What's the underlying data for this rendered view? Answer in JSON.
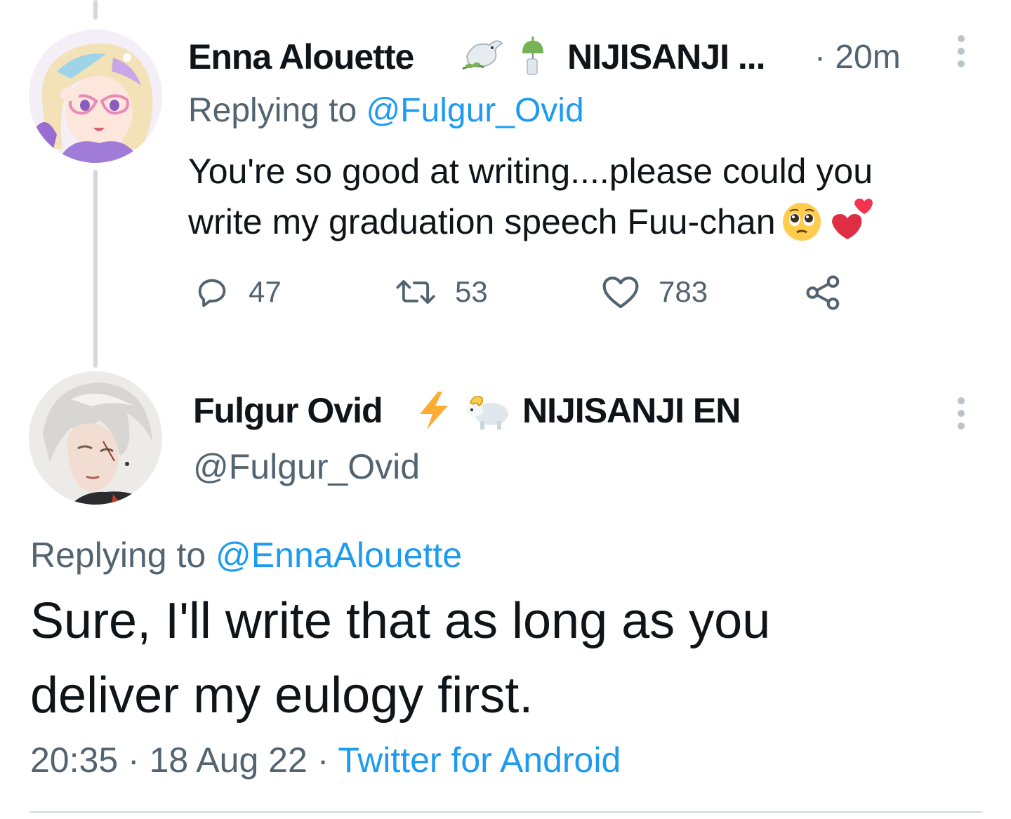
{
  "parent_tweet": {
    "display_name": "Enna Alouette",
    "affiliation": "NIJISANJI ...",
    "name_emojis": [
      "dove-with-olive-icon",
      "wind-chime-icon"
    ],
    "time_prefix": "· ",
    "time": "20m",
    "replying_prefix": "Replying to ",
    "replying_to": "@Fulgur_Ovid",
    "body_line1": "You're so good at writing....please could you",
    "body_line2": "write my graduation speech Fuu-chan",
    "body_emojis": [
      "pleading-face-icon",
      "two-hearts-icon"
    ],
    "stats": {
      "replies": "47",
      "retweets": "53",
      "likes": "783"
    }
  },
  "main_tweet": {
    "display_name": "Fulgur Ovid",
    "affiliation": "NIJISANJI EN",
    "name_emojis": [
      "lightning-icon",
      "ram-icon"
    ],
    "handle": "@Fulgur_Ovid",
    "replying_prefix": "Replying to ",
    "replying_to": "@EnnaAlouette",
    "body_line1": "Sure, I'll write that as long as you",
    "body_line2": "deliver my eulogy first.",
    "time": "20:35",
    "separator1": " · ",
    "date": "18 Aug 22",
    "separator2": " · ",
    "source": "Twitter for Android"
  },
  "colors": {
    "text": "#0f1419",
    "secondary": "#536471",
    "link": "#1d9bf0",
    "thread_line": "#cfd9de"
  }
}
